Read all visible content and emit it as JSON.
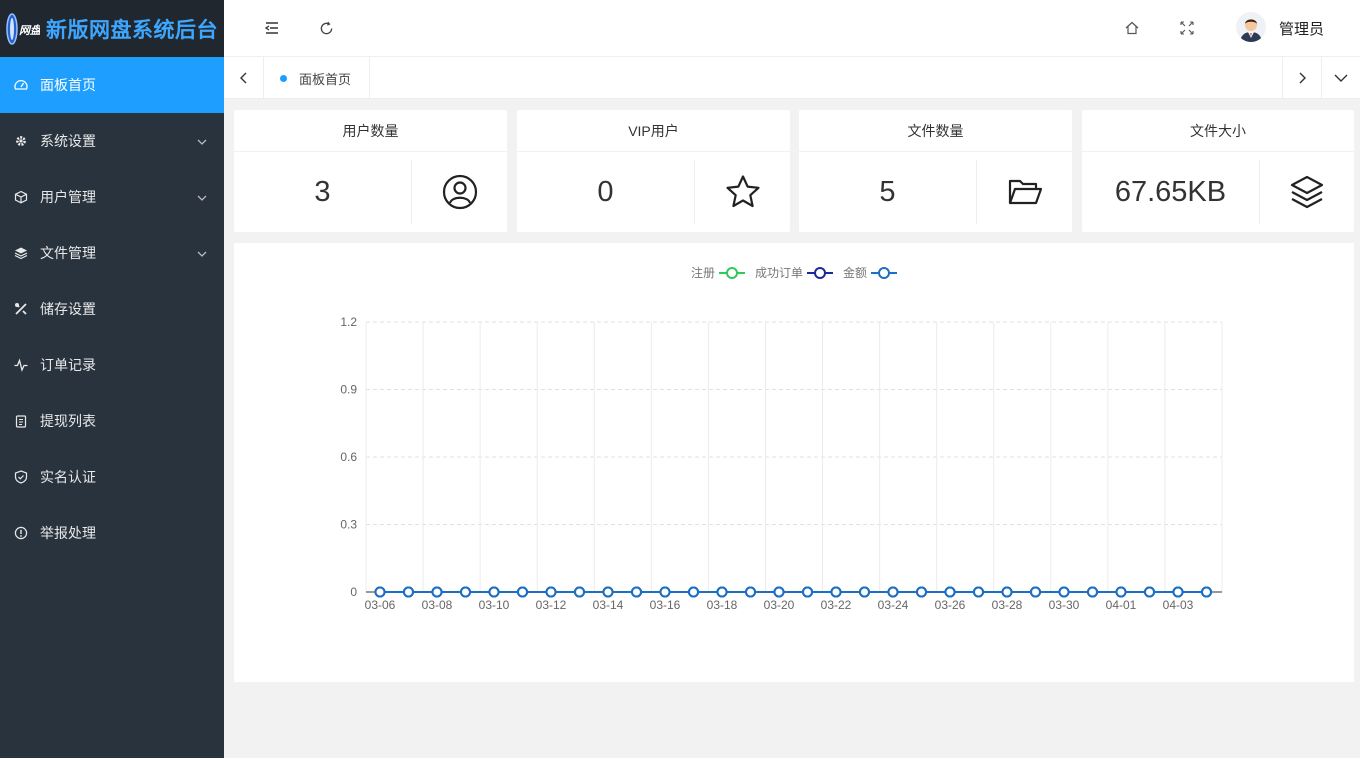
{
  "app": {
    "title": "新版网盘系统后台",
    "logo_mark": "网盘"
  },
  "sidebar": {
    "items": [
      {
        "label": "面板首页",
        "icon": "dashboard-icon",
        "active": true,
        "has_children": false
      },
      {
        "label": "系统设置",
        "icon": "gear-icon",
        "active": false,
        "has_children": true
      },
      {
        "label": "用户管理",
        "icon": "cube-icon",
        "active": false,
        "has_children": true
      },
      {
        "label": "文件管理",
        "icon": "layers-icon",
        "active": false,
        "has_children": true
      },
      {
        "label": "储存设置",
        "icon": "tools-icon",
        "active": false,
        "has_children": false
      },
      {
        "label": "订单记录",
        "icon": "pulse-icon",
        "active": false,
        "has_children": false
      },
      {
        "label": "提现列表",
        "icon": "clipboard-icon",
        "active": false,
        "has_children": false
      },
      {
        "label": "实名认证",
        "icon": "shield-check-icon",
        "active": false,
        "has_children": false
      },
      {
        "label": "举报处理",
        "icon": "info-circle-icon",
        "active": false,
        "has_children": false
      }
    ]
  },
  "header": {
    "admin_name": "管理员",
    "icons": [
      "collapse-menu-icon",
      "refresh-icon",
      "home-icon",
      "fullscreen-icon",
      "avatar"
    ]
  },
  "tabs": [
    {
      "label": "面板首页",
      "active": true
    }
  ],
  "stats": [
    {
      "title": "用户数量",
      "value": "3",
      "icon": "user-circle-icon"
    },
    {
      "title": "VIP用户",
      "value": "0",
      "icon": "star-icon"
    },
    {
      "title": "文件数量",
      "value": "5",
      "icon": "folder-open-icon"
    },
    {
      "title": "文件大小",
      "value": "67.65KB",
      "icon": "layers-icon"
    }
  ],
  "chart_data": {
    "type": "line",
    "x": [
      "03-06",
      "03-07",
      "03-08",
      "03-09",
      "03-10",
      "03-11",
      "03-12",
      "03-13",
      "03-14",
      "03-15",
      "03-16",
      "03-17",
      "03-18",
      "03-19",
      "03-20",
      "03-21",
      "03-22",
      "03-23",
      "03-24",
      "03-25",
      "03-26",
      "03-27",
      "03-28",
      "03-29",
      "03-30",
      "03-31",
      "04-01",
      "04-02",
      "04-03",
      "04-04"
    ],
    "x_tick_labels": [
      "03-06",
      "03-08",
      "03-10",
      "03-12",
      "03-14",
      "03-16",
      "03-18",
      "03-20",
      "03-22",
      "03-24",
      "03-26",
      "03-28",
      "03-30",
      "04-01",
      "04-03"
    ],
    "y_ticks": [
      "0",
      "0.3",
      "0.6",
      "0.9",
      "1.2"
    ],
    "ylim": [
      0,
      1.2
    ],
    "grid": true,
    "legend_position": "top-center",
    "series": [
      {
        "name": "注册",
        "color": "#2ec95c",
        "values": [
          0,
          0,
          0,
          0,
          0,
          0,
          0,
          0,
          0,
          0,
          0,
          0,
          0,
          0,
          0,
          0,
          0,
          0,
          0,
          0,
          0,
          0,
          0,
          0,
          0,
          0,
          0,
          0,
          0,
          0
        ]
      },
      {
        "name": "成功订单",
        "color": "#1b2a9b",
        "values": [
          0,
          0,
          0,
          0,
          0,
          0,
          0,
          0,
          0,
          0,
          0,
          0,
          0,
          0,
          0,
          0,
          0,
          0,
          0,
          0,
          0,
          0,
          0,
          0,
          0,
          0,
          0,
          0,
          0,
          0
        ]
      },
      {
        "name": "金额",
        "color": "#1c6fc4",
        "values": [
          0,
          0,
          0,
          0,
          0,
          0,
          0,
          0,
          0,
          0,
          0,
          0,
          0,
          0,
          0,
          0,
          0,
          0,
          0,
          0,
          0,
          0,
          0,
          0,
          0,
          0,
          0,
          0,
          0,
          0
        ]
      }
    ]
  }
}
